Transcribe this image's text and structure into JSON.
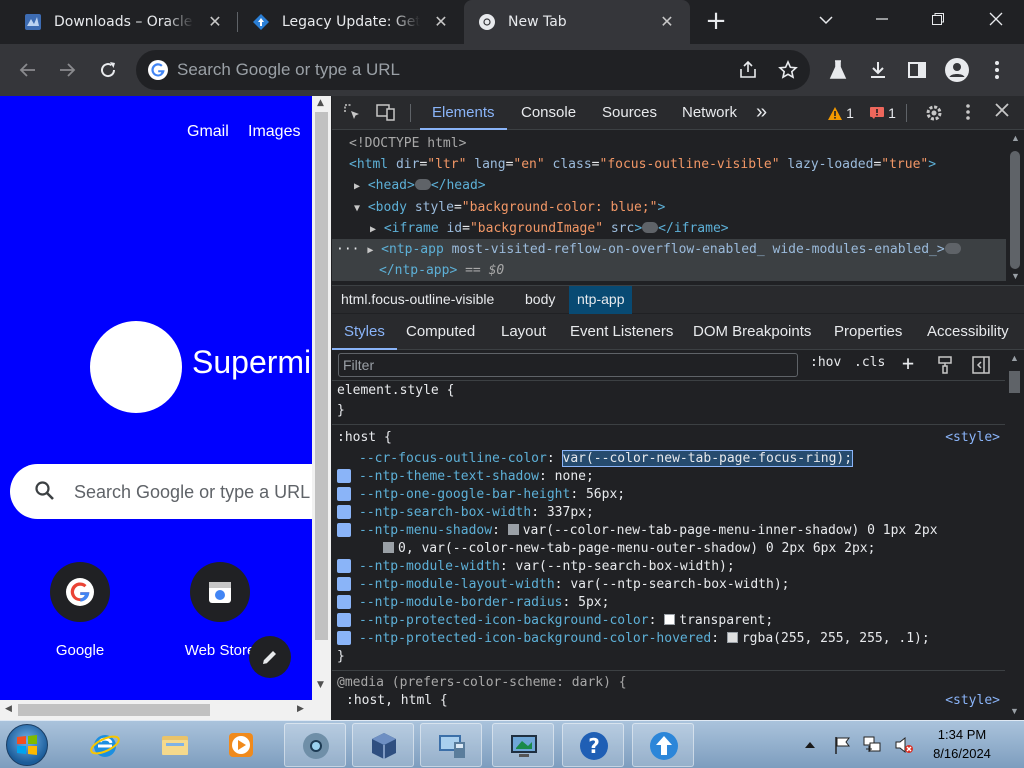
{
  "browser": {
    "tabs": [
      {
        "title": "Downloads – Oracle VM",
        "favicon": "virtualbox-favicon",
        "active": false
      },
      {
        "title": "Legacy Update: Get back",
        "favicon": "legacy-update-favicon",
        "active": false
      },
      {
        "title": "New Tab",
        "favicon": "chrome-favicon",
        "active": true
      }
    ],
    "new_tab_symbol": "+",
    "omnibox_placeholder": "Search Google or type a URL"
  },
  "ntp": {
    "links": [
      "Gmail",
      "Images"
    ],
    "doodle_text": "Supermi",
    "search_placeholder": "Search Google or type a URL",
    "shortcuts": [
      {
        "label": "Google",
        "icon": "google-g-icon"
      },
      {
        "label": "Web Store",
        "icon": "web-store-icon"
      }
    ]
  },
  "devtools": {
    "tabs": [
      "Elements",
      "Console",
      "Sources",
      "Network"
    ],
    "active_tab": "Elements",
    "more_symbol": "»",
    "warnings_count": "1",
    "errors_count": "1",
    "dom": {
      "doctype": "<!DOCTYPE html>",
      "html_tag": "html",
      "html_attrs": [
        {
          "name": "dir",
          "value": "ltr"
        },
        {
          "name": "lang",
          "value": "en"
        },
        {
          "name": "class",
          "value": "focus-outline-visible"
        },
        {
          "name": "lazy-loaded",
          "value": "true"
        }
      ],
      "head_open": "<head>",
      "head_close": "</head>",
      "body_open": "<body",
      "body_attr_name": "style",
      "body_attr_value": "background-color: blue;",
      "iframe_open": "<iframe",
      "iframe_attr_name": "id",
      "iframe_attr_value": "backgroundImage",
      "iframe_src": "src",
      "iframe_close": "</iframe>",
      "ntp_app_open": "<ntp-app",
      "ntp_app_attrs": "most-visited-reflow-on-overflow-enabled_ wide-modules-enabled_>",
      "ntp_app_close": "</ntp-app>",
      "selected_marker": "== $0",
      "dots": "···"
    },
    "breadcrumbs": [
      "html.focus-outline-visible",
      "body",
      "ntp-app"
    ],
    "style_tabs": [
      "Styles",
      "Computed",
      "Layout",
      "Event Listeners",
      "DOM Breakpoints",
      "Properties",
      "Accessibility"
    ],
    "filter_placeholder": "Filter",
    "hov": ":hov",
    "cls": ".cls",
    "styles": {
      "element_style": "element.style {",
      "close_brace": "}",
      "host_selector": ":host {",
      "host_source": "<style>",
      "properties": [
        {
          "name": "--cr-focus-outline-color",
          "value": "var(--color-new-tab-page-focus-ring);",
          "checked": false,
          "swatch": false
        },
        {
          "name": "--ntp-theme-text-shadow",
          "value": "none;",
          "checked": true,
          "swatch": false
        },
        {
          "name": "--ntp-one-google-bar-height",
          "value": "56px;",
          "checked": true,
          "swatch": false
        },
        {
          "name": "--ntp-search-box-width",
          "value": "337px;",
          "checked": true,
          "swatch": false
        },
        {
          "name": "--ntp-menu-shadow",
          "value": "var(--color-new-tab-page-menu-inner-shadow) 0 1px 2px",
          "checked": true,
          "swatch": true
        },
        {
          "name": "",
          "value": "0, var(--color-new-tab-page-menu-outer-shadow) 0 2px 6px 2px;",
          "checked": false,
          "swatch": true
        },
        {
          "name": "--ntp-module-width",
          "value": "var(--ntp-search-box-width);",
          "checked": true,
          "swatch": false
        },
        {
          "name": "--ntp-module-layout-width",
          "value": "var(--ntp-search-box-width);",
          "checked": true,
          "swatch": false
        },
        {
          "name": "--ntp-module-border-radius",
          "value": "5px;",
          "checked": true,
          "swatch": false
        },
        {
          "name": "--ntp-protected-icon-background-color",
          "value": "transparent;",
          "checked": true,
          "swatch": true
        },
        {
          "name": "--ntp-protected-icon-background-color-hovered",
          "value": "rgba(255, 255, 255, .1);",
          "checked": true,
          "swatch": true
        }
      ],
      "media_query": "@media (prefers-color-scheme: dark) {",
      "media_selector": ":host, html {",
      "media_source": "<style>"
    }
  },
  "taskbar": {
    "clock_time": "1:34 PM",
    "clock_date": "8/16/2024",
    "apps": [
      "internet-explorer-icon",
      "file-explorer-icon",
      "media-player-icon",
      "chrome-icon",
      "virtualbox-icon",
      "remote-desktop-icon",
      "display-icon",
      "help-icon",
      "legacy-update-icon"
    ]
  },
  "colors": {
    "ntp_background": "#0000ff",
    "devtools_accent": "#8ab4f8"
  }
}
